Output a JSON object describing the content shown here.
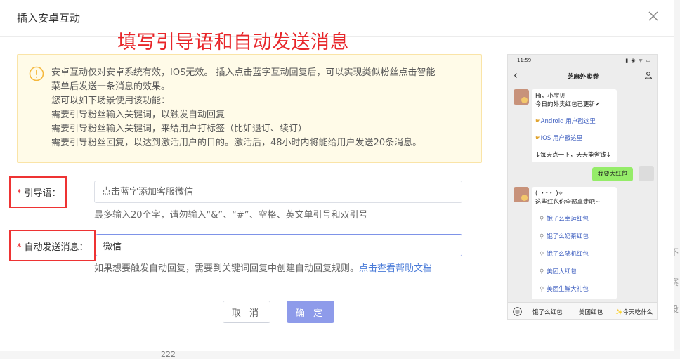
{
  "modal": {
    "title": "插入安卓互动",
    "annotation": "填写引导语和自动发送消息"
  },
  "notice": {
    "lines": [
      "安卓互动仅对安卓系统有效，IOS无效。 插入点击蓝字互动回复后，可以实现类似粉丝点击智能",
      "菜单后发送一条消息的效果。",
      "您可以如下场景使用该功能：",
      "需要引导粉丝输入关键词，以触发自动回复",
      "需要引导粉丝输入关键词，来给用户打标签（比如退订、续订）",
      "需要引导粉丝回复，以达到激活用户的目的。激活后，48小时内将能给用户发送20条消息。"
    ]
  },
  "form": {
    "guide": {
      "required": "*",
      "label": "引导语：",
      "placeholder": "点击蓝字添加客服微信",
      "help": "最多输入20个字，请勿输入“&”、“#”、空格、英文单引号和双引号"
    },
    "auto_message": {
      "required": "*",
      "label": "自动发送消息：",
      "value": "微信",
      "help": "如果想要触发自动回复，需要到关键词回复中创建自动回复规则。",
      "help_link": "点击查看帮助文档"
    }
  },
  "buttons": {
    "cancel": "取 消",
    "ok": "确 定"
  },
  "phone": {
    "time": "11:59",
    "status_icons": "▮ ◉ ᯤ ▭",
    "title": "芝麻外卖券",
    "message1": {
      "greeting": "Hi，小宝贝",
      "line2": "今日的外卖红包已更新✔",
      "android": "Android 用户戳这里",
      "ios": "IOS 用户戳这里",
      "footer": "↓每天点一下，天天能省钱↓"
    },
    "my_message": "我要大红包",
    "message2": {
      "kaomoji": "( ・ᵕ・ )✧",
      "line2": "这些红包你全部拿走吧~",
      "links": [
        "饿了么幸运红包",
        "饿了么奶茶红包",
        "饿了么随机红包",
        "美团大红包",
        "美团生鲜大礼包"
      ]
    },
    "menu": [
      "饿了么红包",
      "美团红包",
      "✨今天吃什么"
    ]
  },
  "background": {
    "side_chars": [
      "不",
      "赛",
      "设"
    ],
    "bottom_number": "222"
  },
  "colors": {
    "annotation_red": "#e8262a",
    "notice_bg": "#fffbe8",
    "notice_icon": "#f5b83d",
    "primary_button": "#8e9bea",
    "link_blue": "#4a7bd8",
    "wechat_green": "#95ec69"
  }
}
